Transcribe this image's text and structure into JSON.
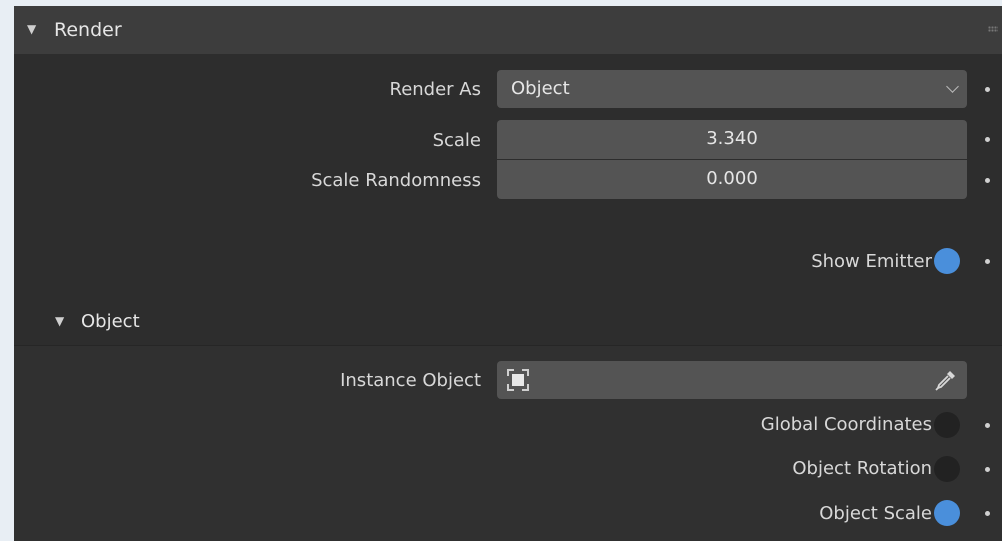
{
  "panel": {
    "title": "Render",
    "render_as": {
      "label": "Render As",
      "value": "Object"
    },
    "scale": {
      "label": "Scale",
      "value": "3.340"
    },
    "scale_randomness": {
      "label": "Scale Randomness",
      "value": "0.000"
    },
    "show_emitter": {
      "label": "Show Emitter",
      "checked": true
    }
  },
  "object_section": {
    "title": "Object",
    "instance_object": {
      "label": "Instance Object",
      "value": ""
    },
    "global_coordinates": {
      "label": "Global Coordinates",
      "checked": false
    },
    "object_rotation": {
      "label": "Object Rotation",
      "checked": false
    },
    "object_scale": {
      "label": "Object Scale",
      "checked": true
    }
  },
  "colors": {
    "accent": "#4a8fdb",
    "panel_bg": "#2d2d2d",
    "header_bg": "#3d3d3d",
    "field_bg": "#545454"
  },
  "icons": [
    "disclosure-triangle-icon",
    "drag-grip-icon",
    "chevron-down-icon",
    "object-icon",
    "eyedropper-icon",
    "keyframe-dot-icon"
  ]
}
